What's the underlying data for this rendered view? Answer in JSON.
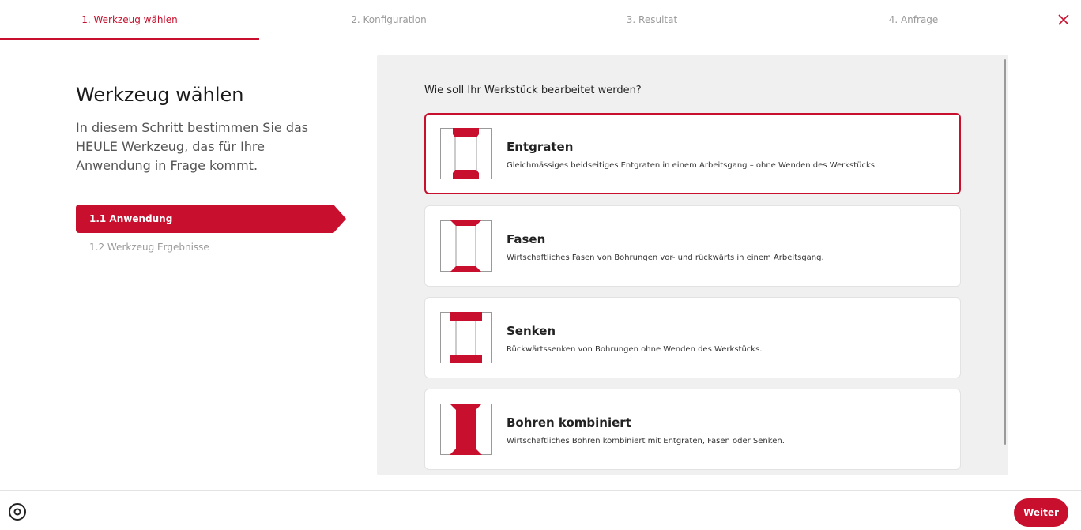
{
  "steps": [
    {
      "label": "1. Werkzeug wählen",
      "active": true
    },
    {
      "label": "2. Konfiguration",
      "active": false
    },
    {
      "label": "3. Resultat",
      "active": false
    },
    {
      "label": "4. Anfrage",
      "active": false
    }
  ],
  "close_icon": "close-icon",
  "left": {
    "title": "Werkzeug wählen",
    "description": "In diesem Schritt bestimmen Sie das HEULE Werkzeug, das für Ihre Anwendung in Frage kommt.",
    "substeps": [
      {
        "label": "1.1  Anwendung",
        "active": true
      },
      {
        "label": "1.2  Werkzeug Ergebnisse",
        "active": false
      }
    ]
  },
  "main": {
    "question": "Wie soll Ihr Werkstück bearbeitet werden?",
    "options": [
      {
        "title": "Entgraten",
        "description": "Gleichmässiges beidseitiges Entgraten in einem Arbeitsgang – ohne Wenden des Werkstücks.",
        "icon": "deburring-icon",
        "selected": true
      },
      {
        "title": "Fasen",
        "description": "Wirtschaftliches Fasen von Bohrungen vor- und rückwärts in einem Arbeitsgang.",
        "icon": "chamfering-icon",
        "selected": false
      },
      {
        "title": "Senken",
        "description": "Rückwärtssenken von Bohrungen ohne Wenden des Werkstücks.",
        "icon": "countersinking-icon",
        "selected": false
      },
      {
        "title": "Bohren kombiniert",
        "description": "Wirtschaftliches Bohren kombiniert mit Entgraten, Fasen oder Senken.",
        "icon": "combined-drilling-icon",
        "selected": false
      }
    ]
  },
  "footer": {
    "settings_icon": "settings-icon",
    "next_label": "Weiter"
  },
  "colors": {
    "accent": "#c8102e",
    "panel_bg": "#f0f0f0",
    "muted_text": "#9a9a9a"
  }
}
